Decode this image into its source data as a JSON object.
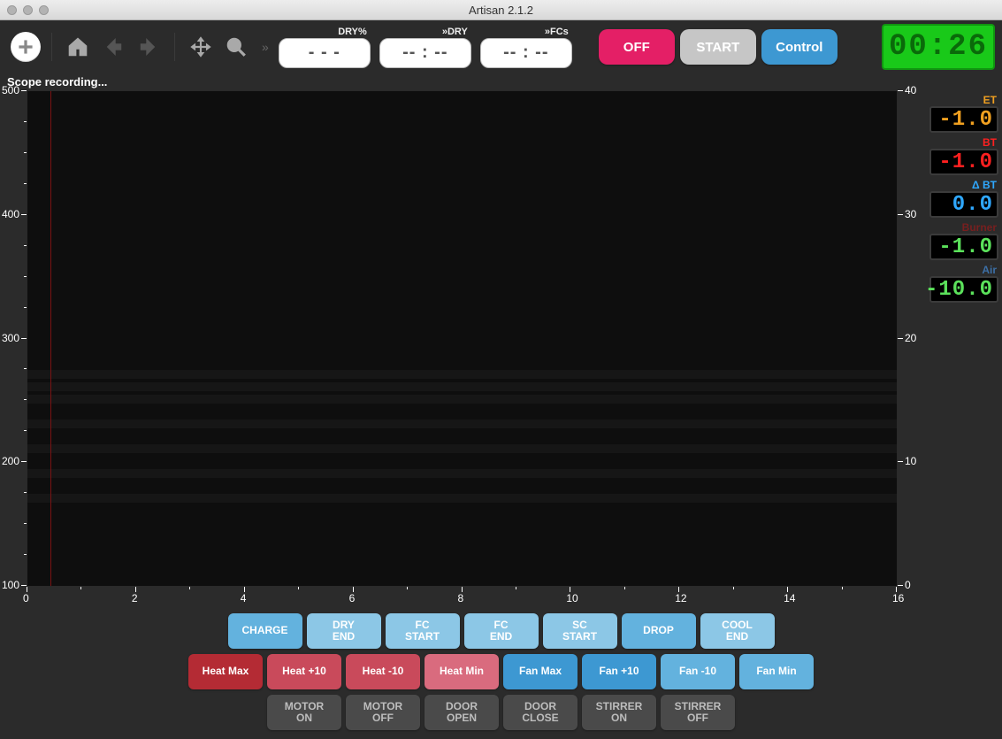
{
  "title": "Artisan 2.1.2",
  "status_text": "Scope recording...",
  "toolbar": {
    "pills": [
      {
        "label": "DRY%",
        "value": "- - -"
      },
      {
        "label": "»DRY",
        "value": "-- : --"
      },
      {
        "label": "»FCs",
        "value": "-- : --"
      }
    ],
    "off_label": "OFF",
    "start_label": "START",
    "control_label": "Control",
    "clock": "00:26"
  },
  "readouts": {
    "et": {
      "label": "ET",
      "value": "-1.0"
    },
    "bt": {
      "label": "BT",
      "value": "-1.0"
    },
    "dbt": {
      "label": "Δ BT",
      "value": "0.0"
    },
    "burner": {
      "label": "Burner",
      "value": "-1.0"
    },
    "air": {
      "label": "Air",
      "value": "-10.0"
    }
  },
  "event_buttons": [
    {
      "label": "CHARGE",
      "cls": "c-lightblue"
    },
    {
      "label": "DRY\nEND",
      "cls": "c-paleblue"
    },
    {
      "label": "FC\nSTART",
      "cls": "c-paleblue"
    },
    {
      "label": "FC\nEND",
      "cls": "c-paleblue"
    },
    {
      "label": "SC\nSTART",
      "cls": "c-paleblue"
    },
    {
      "label": "DROP",
      "cls": "c-lightblue"
    },
    {
      "label": "COOL\nEND",
      "cls": "c-paleblue"
    }
  ],
  "heat_fan_buttons": [
    {
      "label": "Heat Max",
      "cls": "c-red1"
    },
    {
      "label": "Heat +10",
      "cls": "c-red2"
    },
    {
      "label": "Heat -10",
      "cls": "c-red2"
    },
    {
      "label": "Heat Min",
      "cls": "c-red3"
    },
    {
      "label": "Fan Max",
      "cls": "c-blue"
    },
    {
      "label": "Fan +10",
      "cls": "c-blue"
    },
    {
      "label": "Fan -10",
      "cls": "c-lightblue"
    },
    {
      "label": "Fan Min",
      "cls": "c-lightblue"
    }
  ],
  "motor_buttons": [
    {
      "label": "MOTOR\nON",
      "cls": "c-darkgrey"
    },
    {
      "label": "MOTOR\nOFF",
      "cls": "c-darkgrey"
    },
    {
      "label": "DOOR\nOPEN",
      "cls": "c-darkgrey"
    },
    {
      "label": "DOOR\nCLOSE",
      "cls": "c-darkgrey"
    },
    {
      "label": "STIRRER\nON",
      "cls": "c-darkgrey"
    },
    {
      "label": "STIRRER\nOFF",
      "cls": "c-darkgrey"
    }
  ],
  "chart_data": {
    "type": "line",
    "title": "",
    "xlabel": "",
    "ylabel": "",
    "y2label": "",
    "xlim": [
      0,
      16
    ],
    "ylim_left": [
      100,
      500
    ],
    "ylim_right": [
      0,
      40
    ],
    "xticks": [
      0,
      2,
      4,
      6,
      8,
      10,
      12,
      14,
      16
    ],
    "yticks_left": [
      100,
      200,
      300,
      400,
      500
    ],
    "yticks_right": [
      0,
      10,
      20,
      30,
      40
    ],
    "series": [],
    "current_time_marker_x": 0.43,
    "background_bands_y": [
      171,
      191,
      211,
      231,
      251,
      261,
      271
    ]
  }
}
